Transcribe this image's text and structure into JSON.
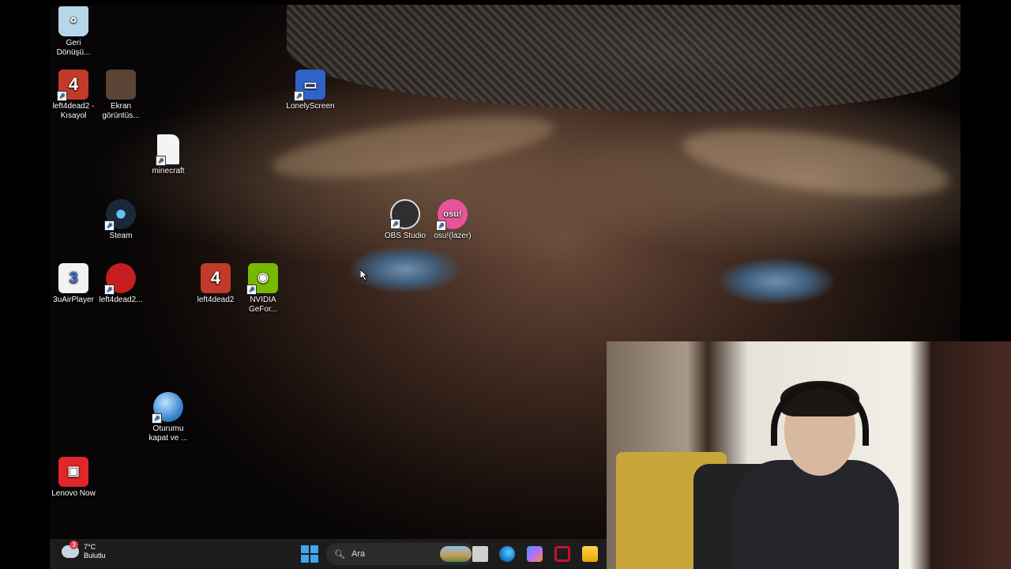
{
  "desktop_icons": [
    {
      "label": "Geri\nDönüşü...",
      "icon": "recycle-bin-icon",
      "color": "#b8d6ea"
    },
    {
      "label": "left4dead2 -\nKısayol",
      "icon": "left4dead2-icon",
      "color": "#c23a2a",
      "glyph": "4"
    },
    {
      "label": "Ekran\ngörüntüs...",
      "icon": "screenshot-thumbnail-icon",
      "color": "#5a4436"
    },
    {
      "label": "LonelyScreen",
      "icon": "lonelyscreen-icon",
      "color": "#2f63c7"
    },
    {
      "label": "minecraft",
      "icon": "file-icon",
      "color": "#f4f4f4"
    },
    {
      "label": "Steam",
      "icon": "steam-icon",
      "color": "#1b2838"
    },
    {
      "label": "OBS Studio",
      "icon": "obs-icon",
      "color": "#302e31"
    },
    {
      "label": "osu!(lazer)",
      "icon": "osu-icon",
      "color": "#e8549c",
      "glyph": "osu!"
    },
    {
      "label": "3uAirPlayer",
      "icon": "3uairplayer-icon",
      "color": "#f2f2f2",
      "glyph": "3"
    },
    {
      "label": "left4dead2...",
      "icon": "left4dead2-shield-icon",
      "color": "#c41e1e"
    },
    {
      "label": "left4dead2",
      "icon": "left4dead2-icon",
      "color": "#c23a2a",
      "glyph": "4"
    },
    {
      "label": "NVIDIA\nGeFor...",
      "icon": "nvidia-icon",
      "color": "#76b900"
    },
    {
      "label": "Oturumu\nkapat ve ...",
      "icon": "globe-icon",
      "color": "#3a8ad0"
    },
    {
      "label": "Lenovo Now",
      "icon": "lenovo-now-icon",
      "color": "#e1252a"
    }
  ],
  "taskbar": {
    "weather_temp": "7°C",
    "weather_desc": "Bulutlu",
    "weather_badge": "3",
    "search_placeholder": "Ara",
    "apps": [
      "task-view-icon",
      "edge-icon",
      "copilot-icon",
      "mcafee-icon",
      "file-explorer-icon"
    ]
  }
}
